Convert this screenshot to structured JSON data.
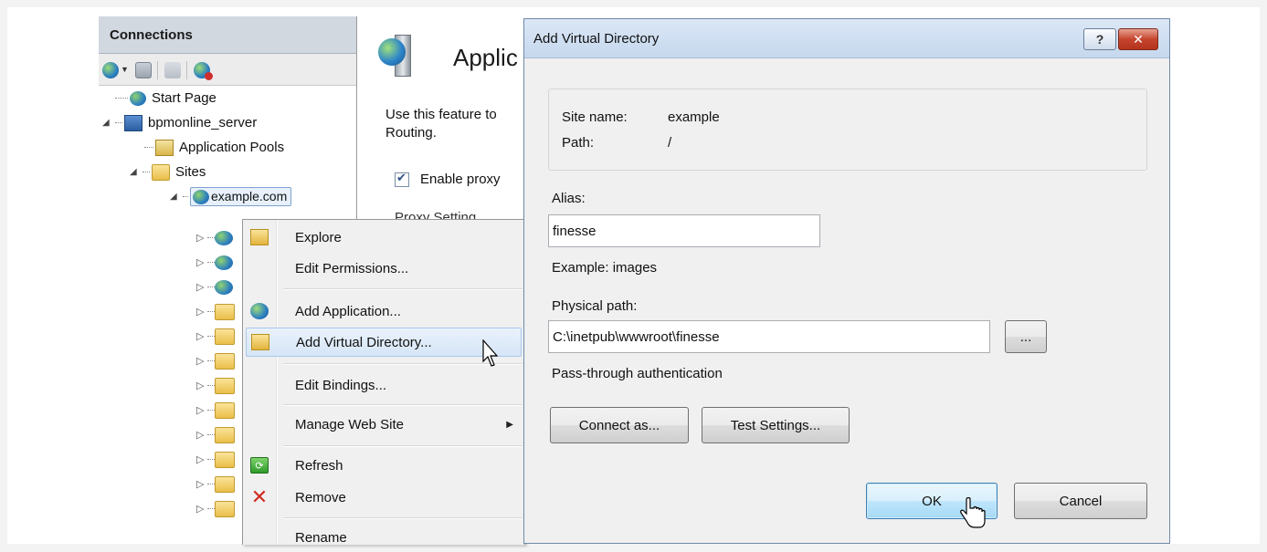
{
  "connections": {
    "title": "Connections",
    "tree": {
      "start_page": "Start Page",
      "server": "bpmonline_server",
      "app_pools": "Application Pools",
      "sites": "Sites",
      "site": "example.com"
    }
  },
  "feature": {
    "title": "Applic",
    "description": "Use this feature to Routing.",
    "checkbox_label": "Enable proxy",
    "section": "Proxy Setting"
  },
  "context_menu": {
    "items": [
      {
        "label": "Explore",
        "icon": "explore-folder-icon"
      },
      {
        "label": "Edit Permissions...",
        "icon": ""
      },
      {
        "label": "Add Application...",
        "icon": "add-application-icon"
      },
      {
        "label": "Add Virtual Directory...",
        "icon": "add-virtual-directory-icon"
      },
      {
        "label": "Edit Bindings...",
        "icon": ""
      },
      {
        "label": "Manage Web Site",
        "icon": ""
      },
      {
        "label": "Refresh",
        "icon": "refresh-icon"
      },
      {
        "label": "Remove",
        "icon": "remove-icon"
      },
      {
        "label": "Rename",
        "icon": ""
      }
    ]
  },
  "dialog": {
    "title": "Add Virtual Directory",
    "help_glyph": "?",
    "close_glyph": "✕",
    "site_name_label": "Site name:",
    "site_name": "example",
    "path_label": "Path:",
    "path": "/",
    "alias_label": "Alias:",
    "alias_value": "finesse",
    "alias_example": "Example: images",
    "physical_path_label": "Physical path:",
    "physical_path_value": "C:\\inetpub\\wwwroot\\finesse",
    "browse_label": "...",
    "auth_label": "Pass-through authentication",
    "connect_as_label": "Connect as...",
    "test_settings_label": "Test Settings...",
    "ok_label": "OK",
    "cancel_label": "Cancel"
  },
  "colors": {
    "titlebar": "#c6d8ee",
    "menu_highlight": "#d5e5f7",
    "default_button": "#bee6fd",
    "close_button": "#c5452e"
  }
}
